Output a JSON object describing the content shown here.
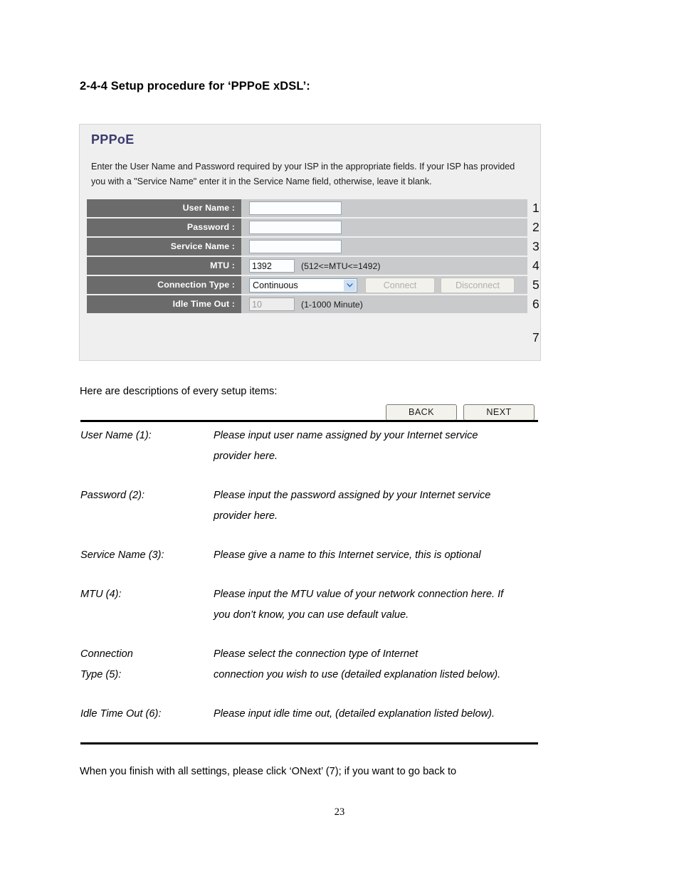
{
  "document": {
    "section_heading": "2-4-4 Setup procedure for ‘PPPoE xDSL’:",
    "intro_line": "Here are descriptions of every setup items:",
    "closing_paragraph": "When you finish with all settings, please click ‘ONext’ (7); if you want to go back to",
    "page_number": "23"
  },
  "ui_panel": {
    "title": "PPPoE",
    "description": "Enter the User Name and Password required by your ISP in the appropriate fields. If your ISP has provided you with a \"Service Name\" enter it in the Service Name field, otherwise, leave it blank.",
    "rows": [
      {
        "label": "User Name :",
        "value": "",
        "hint": "",
        "step": "1"
      },
      {
        "label": "Password :",
        "value": "",
        "hint": "",
        "step": "2"
      },
      {
        "label": "Service Name :",
        "value": "",
        "hint": "",
        "step": "3"
      },
      {
        "label": "MTU :",
        "value": "1392",
        "hint": "(512<=MTU<=1492)",
        "step": "4"
      },
      {
        "label": "Connection Type :",
        "value": "Continuous",
        "hint": "",
        "step": "5"
      },
      {
        "label": "Idle Time Out :",
        "value": "10",
        "hint": "(1-1000 Minute)",
        "step": "6"
      }
    ],
    "connection_type_selected": "Continuous",
    "connect_button": "Connect",
    "disconnect_button": "Disconnect",
    "back_button": "BACK",
    "next_button": "NEXT",
    "actions_step": "7",
    "colors": {
      "panel_background": "#efeff0",
      "label_background": "#6b6b6b",
      "row_background": "#c9cacb",
      "title_color": "#3b3b6d",
      "select_arrow": "#1a5fb4"
    }
  },
  "descriptions": [
    {
      "term_lines": [
        "User Name (1):"
      ],
      "definition_lines": [
        "Please input user name assigned by your Internet service",
        "provider here."
      ]
    },
    {
      "term_lines": [
        "Password (2):"
      ],
      "definition_lines": [
        "Please input the password assigned by your Internet service",
        "provider here."
      ]
    },
    {
      "term_lines": [
        "Service Name (3):"
      ],
      "definition_lines": [
        "Please give a name to this Internet service, this is optional"
      ]
    },
    {
      "term_lines": [
        "MTU (4):"
      ],
      "definition_lines": [
        "Please input the MTU value of your network connection here. If",
        "you don’t know, you can use default value."
      ]
    },
    {
      "term_lines": [
        "Connection",
        "Type (5):"
      ],
      "definition_lines": [
        "Please select the connection type of Internet",
        "connection you wish to use (detailed explanation listed below)."
      ]
    },
    {
      "term_lines": [
        "Idle Time Out (6):"
      ],
      "definition_lines": [
        "Please input idle time out, (detailed explanation listed below)."
      ]
    }
  ]
}
